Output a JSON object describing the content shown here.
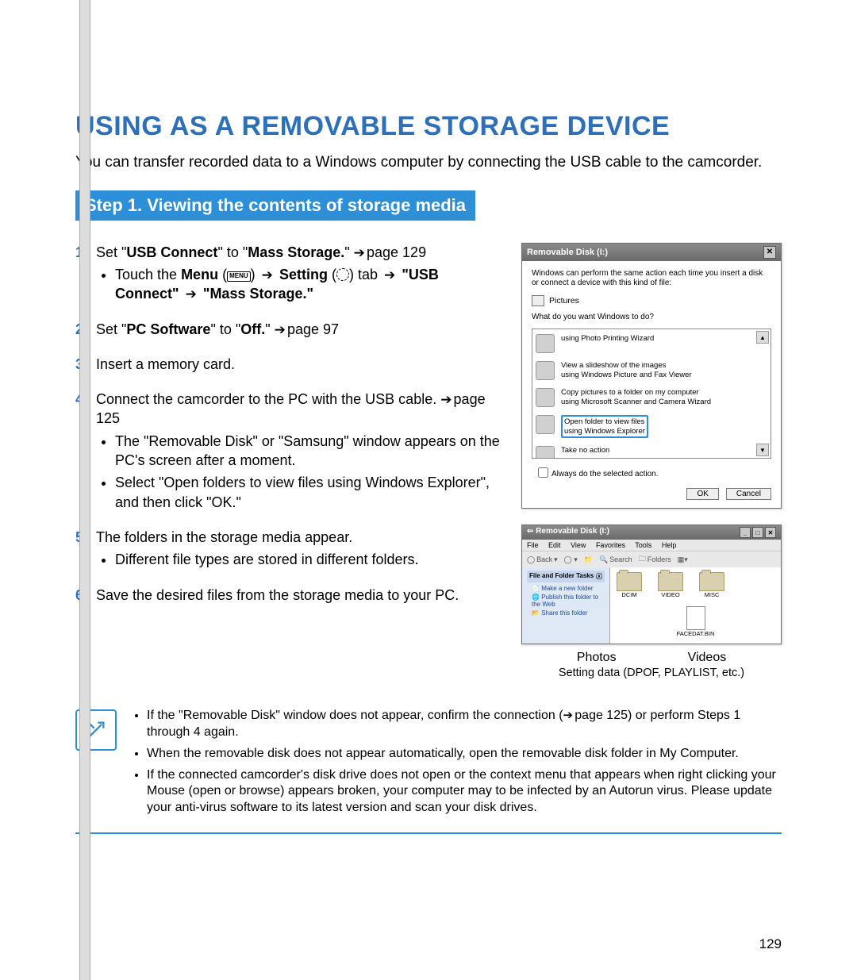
{
  "title": "USING AS A REMOVABLE STORAGE DEVICE",
  "intro": "You can transfer recorded data to a Windows computer by connecting the USB cable to the camcorder.",
  "step_banner": "Step 1. Viewing the contents of storage media",
  "steps": {
    "s1": {
      "num": "1.",
      "a": "Set \"",
      "b": "USB Connect",
      "c": "\" to \"",
      "d": "Mass Storage.",
      "e": "\" ",
      "f": "page 129"
    },
    "s1b": {
      "a": "Touch the ",
      "b": "Menu",
      "menu": "MENU",
      "c": " ",
      "d": "Setting",
      "e": " tab ",
      "f": "\"USB Connect\"",
      "g": " ",
      "h": "\"Mass Storage.\""
    },
    "s2": {
      "num": "2.",
      "a": "Set \"",
      "b": "PC Software",
      "c": "\" to \"",
      "d": "Off.",
      "e": "\" ",
      "f": "page 97"
    },
    "s3": {
      "num": "3.",
      "a": "Insert a memory card."
    },
    "s4": {
      "num": "4.",
      "a": "Connect the camcorder to the PC with the USB cable. ",
      "f": "page 125"
    },
    "s4b1": "The \"Removable Disk\" or \"Samsung\" window appears on the PC's screen after a moment.",
    "s4b2": "Select \"Open folders to view files using Windows Explorer\", and then click \"OK.\"",
    "s5": {
      "num": "5.",
      "a": "The folders in the storage media appear."
    },
    "s5b": "Different file types are stored in different folders.",
    "s6": {
      "num": "6.",
      "a": "Save the desired files from the storage media to your PC."
    }
  },
  "dialog": {
    "title": "Removable Disk (I:)",
    "msg": "Windows can perform the same action each time you insert a disk or connect a device with this kind of file:",
    "pictures": "Pictures",
    "question": "What do you want Windows to do?",
    "opt1a": "using Photo Printing Wizard",
    "opt2a": "View a slideshow of the images",
    "opt2b": "using Windows Picture and Fax Viewer",
    "opt3a": "Copy pictures to a folder on my computer",
    "opt3b": "using Microsoft Scanner and Camera Wizard",
    "opt4a": "Open folder to view files",
    "opt4b": "using Windows Explorer",
    "opt5a": "Take no action",
    "always": "Always do the selected action.",
    "ok": "OK",
    "cancel": "Cancel"
  },
  "explorer": {
    "title": "Removable Disk (I:)",
    "menu": {
      "file": "File",
      "edit": "Edit",
      "view": "View",
      "fav": "Favorites",
      "tools": "Tools",
      "help": "Help"
    },
    "toolbar": {
      "back": "Back",
      "search": "Search",
      "folders": "Folders"
    },
    "panel": {
      "head": "File and Folder Tasks",
      "i1": "Make a new folder",
      "i2": "Publish this folder to the Web",
      "i3": "Share this folder"
    },
    "folders": {
      "f1": "DCIM",
      "f2": "VIDEO",
      "f3": "MISC",
      "file": "FACEDAT.BIN"
    }
  },
  "captions": {
    "photos": "Photos",
    "videos": "Videos",
    "setting": "Setting data (DPOF, PLAYLIST, etc.)"
  },
  "notes": {
    "n1a": "If the \"Removable Disk\" window does not appear, confirm the connection (",
    "n1b": "page 125) or perform Steps 1 through 4 again.",
    "n2": "When the removable disk does not appear automatically, open the removable disk folder in My Computer.",
    "n3": "If the connected camcorder's disk drive does not open or the context menu that appears when right clicking your Mouse (open or browse) appears broken, your computer may to be infected by an Autorun virus. Please update your anti-virus software to its latest version and scan your disk drives."
  },
  "page_number": "129"
}
